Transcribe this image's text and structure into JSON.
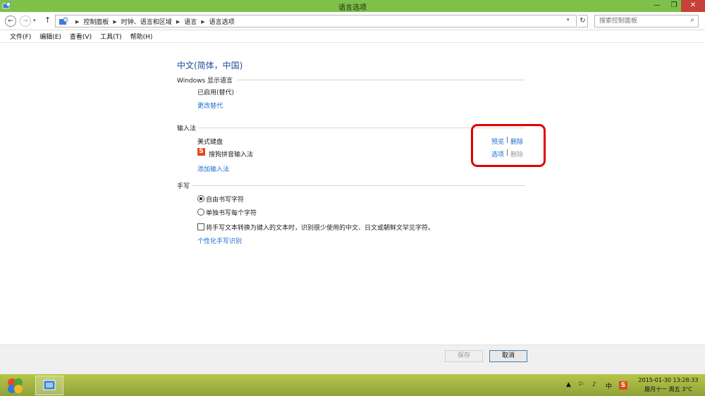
{
  "window": {
    "title": "语言选项",
    "min_label": "—",
    "max_label": "❐",
    "close_label": "✕"
  },
  "address": {
    "crumbs": [
      "控制面板",
      "时钟、语言和区域",
      "语言",
      "语言选项"
    ],
    "search_placeholder": "搜索控制面板"
  },
  "menu": [
    "文件(F)",
    "编辑(E)",
    "查看(V)",
    "工具(T)",
    "帮助(H)"
  ],
  "language": {
    "title": "中文(简体，中国)"
  },
  "display_language": {
    "label": "Windows 显示语言",
    "status": "已启用(替代)",
    "change_link": "更改替代"
  },
  "input_methods": {
    "label": "输入法",
    "items": [
      {
        "name": "美式键盘",
        "action1": "预览",
        "action2": "删除",
        "action2_enabled": true
      },
      {
        "name": "搜狗拼音输入法",
        "icon": "sogou-icon",
        "action1": "选项",
        "action2": "删除",
        "action2_enabled": false
      }
    ],
    "add_link": "添加输入法"
  },
  "handwriting": {
    "label": "手写",
    "options": [
      {
        "label": "自由书写字符",
        "selected": true
      },
      {
        "label": "单独书写每个字符",
        "selected": false
      }
    ],
    "checkbox_label": "将手写文本转换为键入的文本时，识别很少使用的中文、日文或朝鲜文罕见字符。",
    "checkbox_checked": false,
    "personalize_link": "个性化手写识别"
  },
  "buttons": {
    "save": "保存",
    "cancel": "取消"
  },
  "taskbar": {
    "ime_indicator": "中",
    "clock_line1": "2015-01-30  13:28:33",
    "clock_line2": "腊月十一 周五 3°C"
  },
  "colors": {
    "titlebar": "#7ec04a",
    "link": "#1b6ed1",
    "highlight": "#e00000",
    "close": "#c7413a"
  }
}
